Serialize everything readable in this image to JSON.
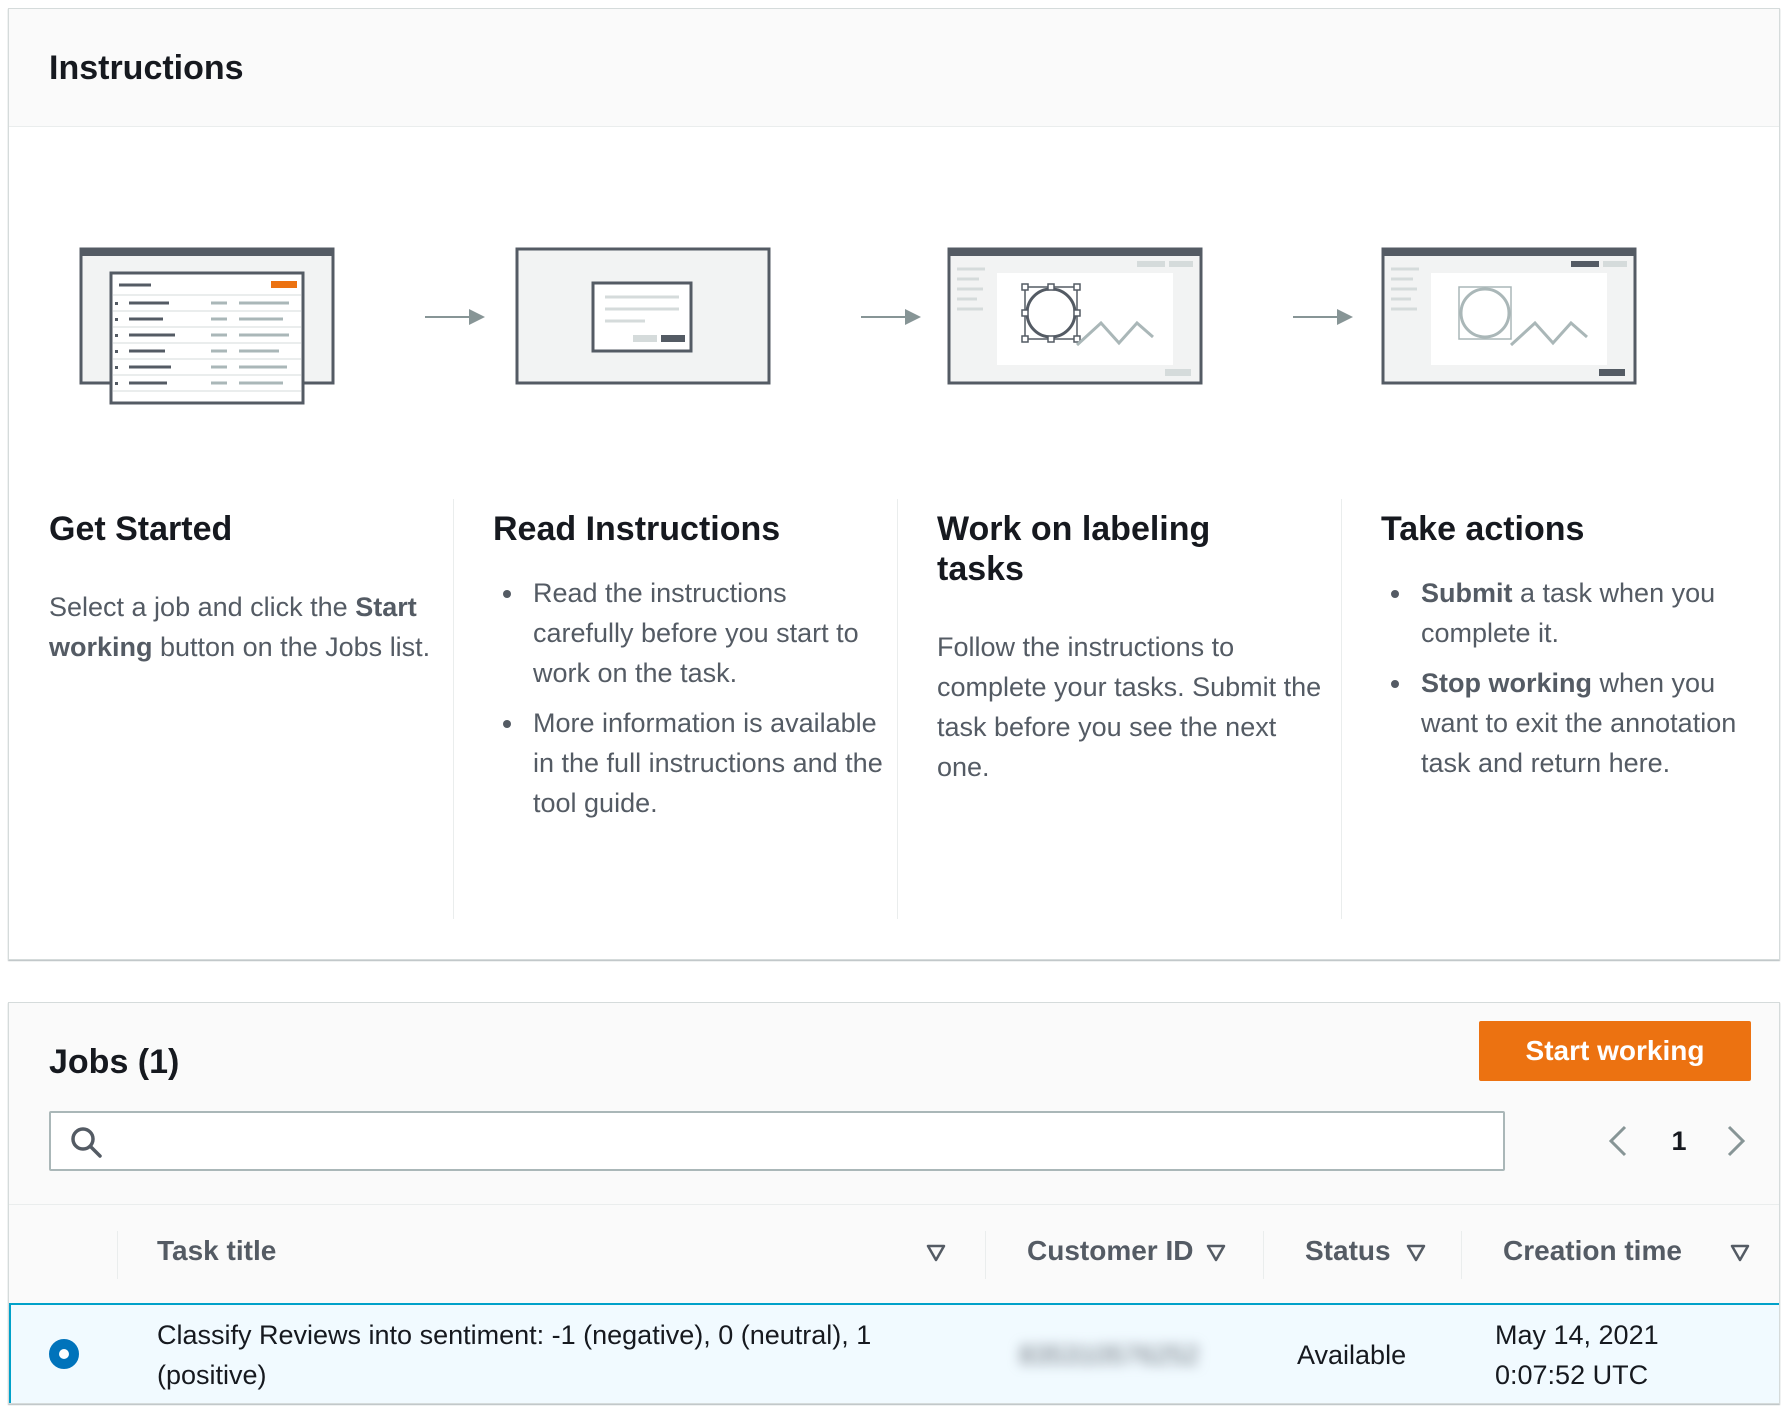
{
  "instructions": {
    "title": "Instructions",
    "steps": [
      {
        "title": "Get Started",
        "text_parts": [
          "Select a job and click the ",
          "Start working",
          " button on the Jobs list."
        ]
      },
      {
        "title": "Read Instructions",
        "bullets": [
          "Read the instructions carefully before you start to work on the task.",
          "More information is available in the full instructions and the tool guide."
        ]
      },
      {
        "title": "Work on labeling tasks",
        "text": "Follow the instructions to complete your tasks. Submit the task before you see the next one."
      },
      {
        "title": "Take actions",
        "bullets": [
          {
            "bold": "Submit",
            "rest": " a task when you complete it."
          },
          {
            "bold": "Stop working",
            "rest": " when you want to exit the annotation task and return here."
          }
        ]
      }
    ]
  },
  "jobs": {
    "title": "Jobs (1)",
    "start_button": "Start working",
    "search": {
      "value": "",
      "placeholder": ""
    },
    "pagination": {
      "current_page": "1"
    },
    "columns": [
      "Task title",
      "Customer ID",
      "Status",
      "Creation time"
    ],
    "rows": [
      {
        "selected": true,
        "task_title_line1": "Classify Reviews into sentiment: -1 (negative), 0 (neutral), 1",
        "task_title_line2": "(positive)",
        "customer_id": "835310576252",
        "status": "Available",
        "creation_date": "May 14, 2021",
        "creation_clock": "0:07:52 UTC"
      }
    ]
  },
  "colors": {
    "accent_orange": "#ec7211",
    "selected_row_bg": "#f1faff",
    "selected_row_border": "#00a1c9",
    "radio_blue": "#0073bb",
    "text_primary": "#16191f",
    "text_secondary": "#545b64"
  },
  "icons": [
    "search-icon",
    "chevron-left-icon",
    "chevron-right-icon",
    "sort-down-icon",
    "arrow-right-icon"
  ]
}
